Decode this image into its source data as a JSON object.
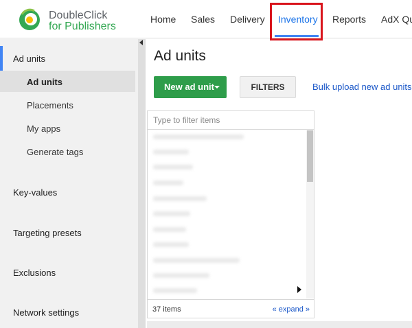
{
  "logo": {
    "line1": "DoubleClick",
    "line2": "for Publishers"
  },
  "nav": {
    "home": "Home",
    "sales": "Sales",
    "delivery": "Delivery",
    "inventory": "Inventory",
    "reports": "Reports",
    "adx": "AdX Que"
  },
  "sidebar": {
    "ad_units_section": "Ad units",
    "items": [
      "Ad units",
      "Placements",
      "My apps",
      "Generate tags"
    ],
    "key_values": "Key-values",
    "targeting_presets": "Targeting presets",
    "exclusions": "Exclusions",
    "network_settings": "Network settings"
  },
  "main": {
    "title": "Ad units",
    "new_button": "New ad unit",
    "filters_button": "FILTERS",
    "bulk_link": "Bulk upload new ad units",
    "filter_placeholder": "Type to filter items",
    "count": "37 items",
    "expand": "« expand »"
  },
  "colors": {
    "accent": "#4285f4",
    "primary_button": "#2e9d4a",
    "highlight": "#d9141c",
    "link": "#1a57c8"
  }
}
